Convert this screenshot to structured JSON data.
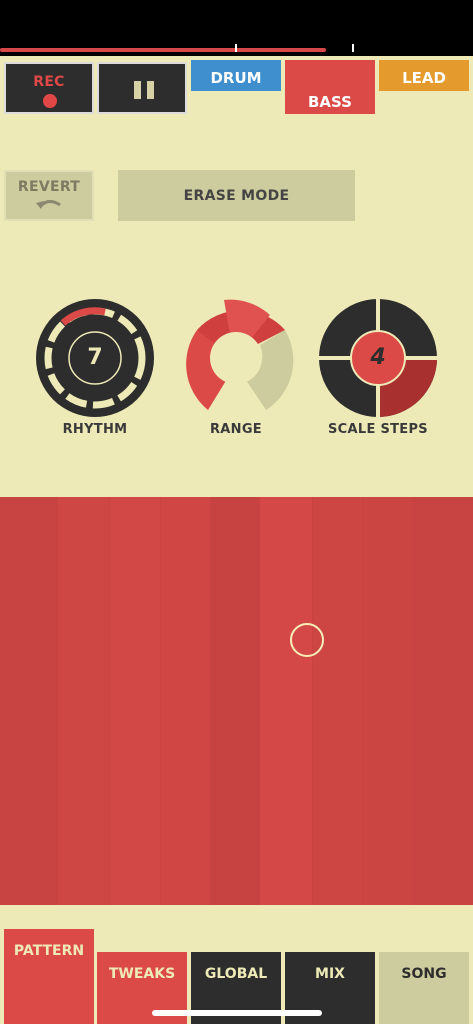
{
  "status_bar": {
    "playback_progress_percent": 69
  },
  "top_controls": {
    "rec_label": "REC",
    "pause_icon": "pause-icon"
  },
  "instrument_tabs": [
    {
      "label": "DRUM",
      "color": "#3f8fce",
      "selected": false
    },
    {
      "label": "BASS",
      "color": "#dc4a47",
      "selected": true
    },
    {
      "label": "LEAD",
      "color": "#e59a2d",
      "selected": false
    }
  ],
  "edit": {
    "revert_label": "REVERT",
    "revert_icon": "undo-arrow-icon",
    "erase_label": "ERASE MODE"
  },
  "dials": {
    "rhythm": {
      "label": "RHYTHM",
      "value": "7"
    },
    "range": {
      "label": "RANGE"
    },
    "scale_steps": {
      "label": "SCALE STEPS",
      "value": "4"
    }
  },
  "bottom_nav": [
    {
      "label": "PATTERN",
      "selected": true
    },
    {
      "label": "TWEAKS",
      "selected": false
    },
    {
      "label": "GLOBAL",
      "selected": false
    },
    {
      "label": "MIX",
      "selected": false
    },
    {
      "label": "SONG",
      "selected": false
    }
  ],
  "colors": {
    "background": "#eeeab7",
    "accent_red": "#dc4a47",
    "dark": "#2d2d2d",
    "muted": "#cdcc9e"
  }
}
